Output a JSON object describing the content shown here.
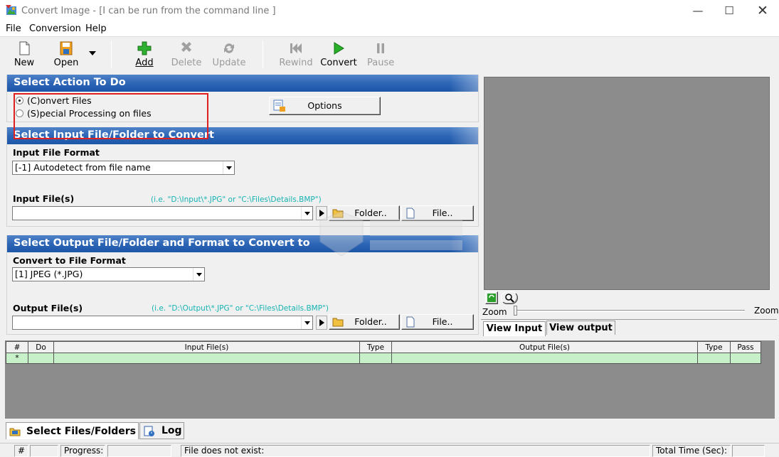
{
  "window": {
    "title": "Convert Image - [I can be run from the command line ]",
    "minimize": "—",
    "maximize": "☐",
    "close": "✕"
  },
  "menu": [
    "File",
    "Conversion",
    "Help"
  ],
  "toolbar": {
    "new": "New",
    "open": "Open",
    "add": "Add",
    "delete": "Delete",
    "update": "Update",
    "rewind": "Rewind",
    "convert": "Convert",
    "pause": "Pause"
  },
  "action_section": {
    "title": "Select Action To Do",
    "convert_files": "(C)onvert Files",
    "special_processing": "(S)pecial Processing on files",
    "options_button": "Options"
  },
  "input_section": {
    "title": "Select Input File/Folder to Convert",
    "format_label": "Input File Format",
    "format_value": "[-1] Autodetect from file name",
    "files_label": "Input File(s)",
    "files_hint": "(i.e. \"D:\\Input\\*.JPG\" or \"C:\\Files\\Details.BMP\")",
    "files_value": "",
    "folder_button": "Folder..",
    "file_button": "File.."
  },
  "output_section": {
    "title": "Select Output File/Folder and Format to Convert to",
    "format_label": "Convert to File Format",
    "format_value": "[1] JPEG (*.JPG)",
    "files_label": "Output File(s)",
    "files_hint": "(i.e. \"D:\\Output\\*.JPG\" or \"C:\\Files\\Details.BMP\")",
    "files_value": "",
    "folder_button": "Folder..",
    "file_button": "File.."
  },
  "preview": {
    "zoom_left": "Zoom",
    "zoom_right": "Zoom",
    "view_input": "View Input",
    "view_output": "View output"
  },
  "grid": {
    "headers": [
      "#",
      "Do",
      "Input File(s)",
      "Type",
      "Output File(s)",
      "Type",
      "Pass"
    ],
    "new_row_marker": "*"
  },
  "bottom_tabs": {
    "select_files": "Select Files/Folders",
    "log": "Log"
  },
  "statusbar": {
    "hash": "#",
    "progress": "Progress:",
    "message": "File does not exist:",
    "total_time": "Total Time (Sec):"
  },
  "colors": {
    "band_blue": "#2e66b6",
    "highlight_red": "#e02020",
    "hint_teal": "#17b3b3",
    "grid_row_green": "#c8f0c8"
  }
}
